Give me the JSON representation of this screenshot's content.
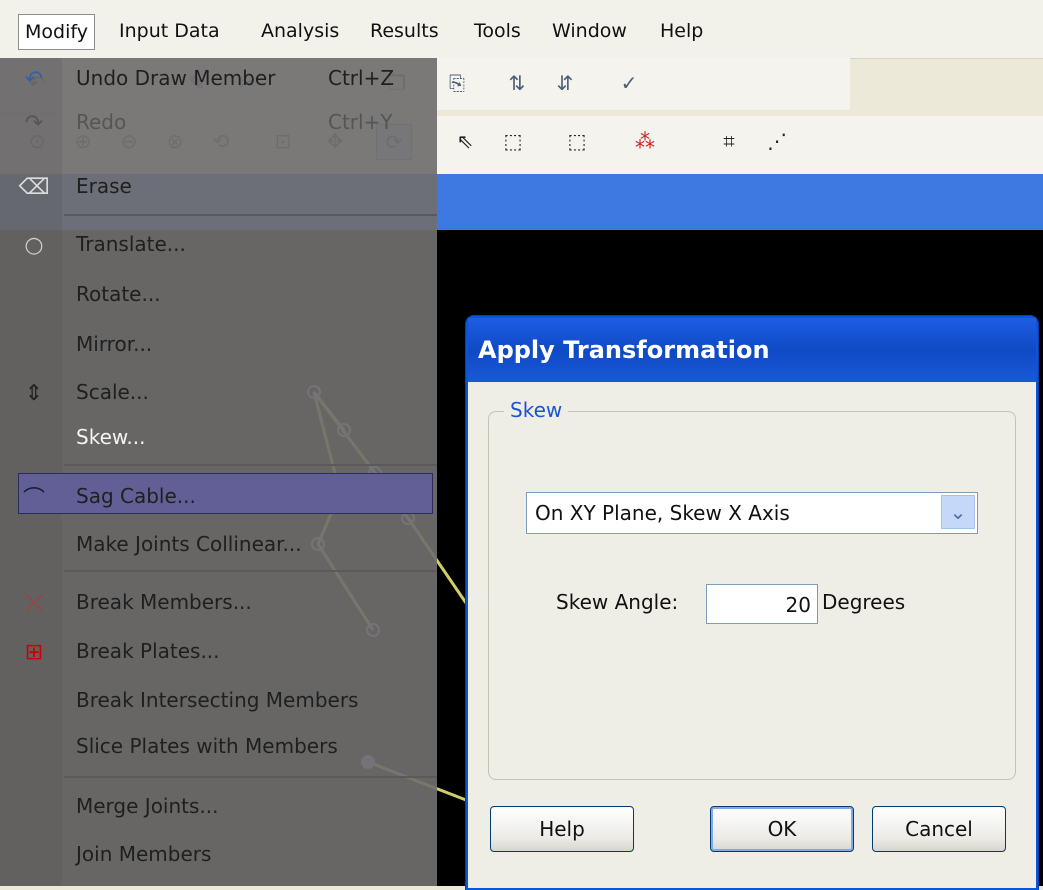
{
  "menubar": {
    "items": [
      "Modify",
      "Input Data",
      "Analysis",
      "Results",
      "Tools",
      "Window",
      "Help"
    ],
    "accelerators": [
      "",
      "I",
      "A",
      "",
      "T",
      "W",
      "H"
    ]
  },
  "toolbar": {
    "row1_icons": [
      "undo-icon",
      "redo-icon",
      "edit-icon",
      "cut-icon",
      "copy-icon",
      "paste-icon",
      "sort-ascending-icon",
      "sort-descending-icon",
      "check-icon"
    ],
    "row2_icons": [
      "zoom-fit-icon",
      "zoom-in-icon",
      "zoom-out-icon",
      "zoom-window-icon",
      "zoom-previous-icon",
      "zoom-dynamic-icon",
      "pan-icon",
      "rotate-icon",
      "select-arrow-icon",
      "select-box-add-icon",
      "select-box-remove-icon",
      "select-joint-icon",
      "snap-grid-icon",
      "grid-icon"
    ]
  },
  "dropdown": {
    "items": [
      {
        "label": "Undo Draw Member",
        "shortcut": "Ctrl+Z",
        "icon": "undo-icon"
      },
      {
        "label": "Redo",
        "shortcut": "Ctrl+Y",
        "icon": "redo-icon"
      },
      {
        "label": "Erase",
        "shortcut": "",
        "icon": "eraser-icon"
      },
      {
        "label": "Translate...",
        "shortcut": "",
        "icon": "translate-icon"
      },
      {
        "label": "Rotate...",
        "shortcut": "",
        "icon": ""
      },
      {
        "label": "Mirror...",
        "shortcut": "",
        "icon": ""
      },
      {
        "label": "Scale...",
        "shortcut": "",
        "icon": "scale-icon"
      },
      {
        "label": "Skew...",
        "shortcut": "",
        "icon": ""
      },
      {
        "label": "Sag Cable...",
        "shortcut": "",
        "icon": "cable-icon"
      },
      {
        "label": "Make Joints Collinear...",
        "shortcut": "",
        "icon": ""
      },
      {
        "label": "Break Members...",
        "shortcut": "",
        "icon": "break-members-icon"
      },
      {
        "label": "Break Plates...",
        "shortcut": "",
        "icon": "break-plates-icon"
      },
      {
        "label": "Break Intersecting Members",
        "shortcut": "",
        "icon": ""
      },
      {
        "label": "Slice Plates with Members",
        "shortcut": "",
        "icon": ""
      },
      {
        "label": "Merge Joints...",
        "shortcut": "",
        "icon": ""
      },
      {
        "label": "Join Members",
        "shortcut": "",
        "icon": ""
      }
    ]
  },
  "dialog": {
    "title": "Apply Transformation",
    "group_label": "Skew",
    "plane_select": {
      "value": "On XY Plane, Skew X Axis"
    },
    "skew_angle_label": "Skew Angle:",
    "skew_angle_value": "20",
    "units_label": "Degrees",
    "buttons": {
      "help": "Help",
      "ok": "OK",
      "cancel": "Cancel"
    }
  },
  "colors": {
    "title_bar": "#0f4ac4",
    "selection_highlight": "#615f96",
    "menu_overlay": "#706f6e",
    "canvas": "#000000",
    "model_lines": "#f2f27a",
    "joints": "#9fa4ff"
  }
}
